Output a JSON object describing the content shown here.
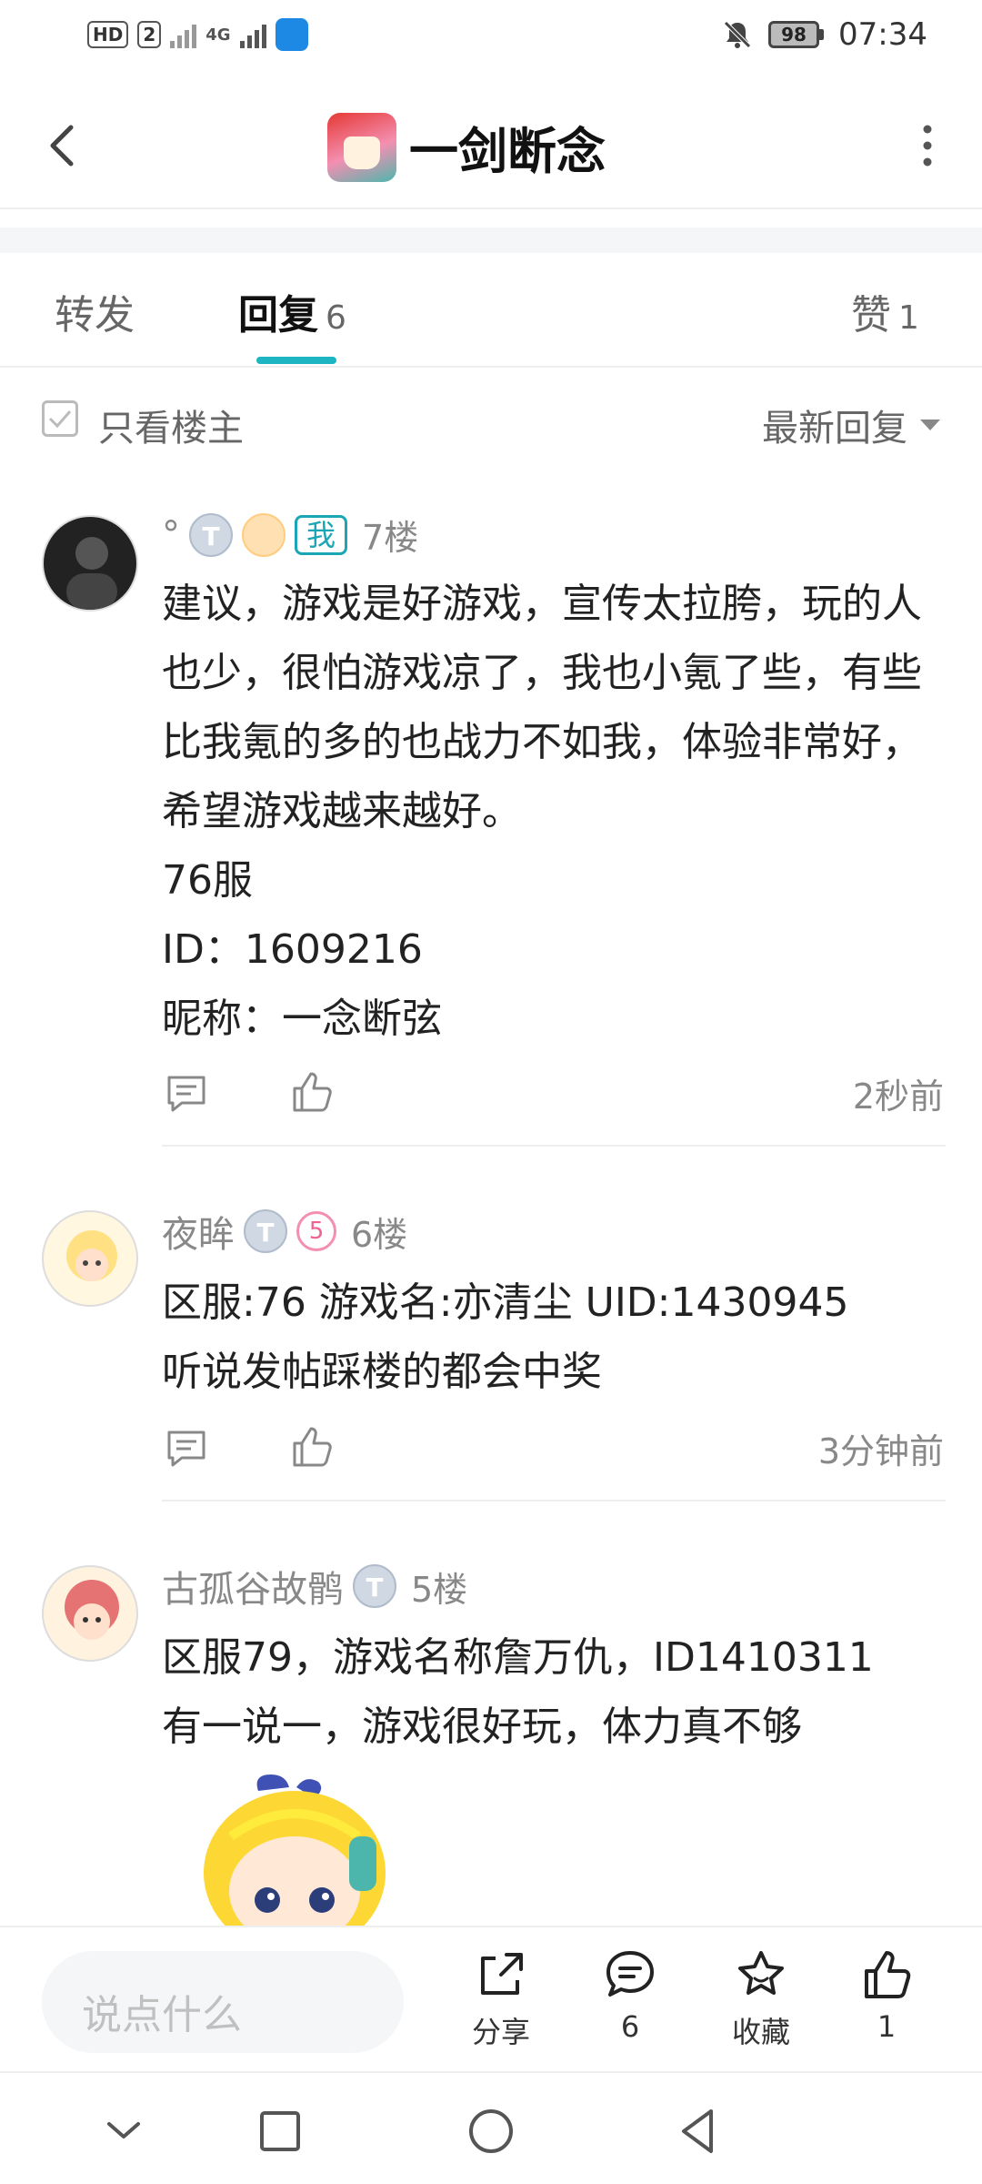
{
  "status_bar": {
    "hd_label": "HD",
    "sim_label": "2",
    "network_label": "4G",
    "battery": "98",
    "time": "07:34"
  },
  "header": {
    "title": "一剑断念"
  },
  "tabs": [
    {
      "label": "转发",
      "count": ""
    },
    {
      "label": "回复",
      "count": "6"
    },
    {
      "label": "赞",
      "count": "1"
    }
  ],
  "filter": {
    "only_owner": "只看楼主",
    "sort": "最新回复"
  },
  "comments": [
    {
      "username": "°",
      "level_badge": "T",
      "me_badge": "我",
      "floor": "7楼",
      "lines": [
        "建议，游戏是好游戏，宣传太拉胯，玩的人也少，很怕游戏凉了，我也小氪了些，有些比我氪的多的也战力不如我，体验非常好，希望游戏越来越好。",
        "76服",
        "ID：1609216",
        "昵称：一念断弦"
      ],
      "time": "2秒前"
    },
    {
      "username": "夜眸",
      "level_badge": "T",
      "extra_badge": "5",
      "floor": "6楼",
      "lines": [
        "区服:76 游戏名:亦清尘 UID:1430945",
        "听说发帖踩楼的都会中奖"
      ],
      "time": "3分钟前"
    },
    {
      "username": "古孤谷故鹘",
      "level_badge": "T",
      "floor": "5楼",
      "lines": [
        "区服79，游戏名称詹万仇，ID1410311",
        "有一说一，游戏很好玩，体力真不够"
      ]
    }
  ],
  "bottom_bar": {
    "input_placeholder": "说点什么",
    "share_label": "分享",
    "comment_count": "6",
    "favorite_label": "收藏",
    "like_count": "1"
  },
  "colors": {
    "accent": "#1db5c2",
    "text_primary": "#222222",
    "text_secondary": "#888888"
  }
}
